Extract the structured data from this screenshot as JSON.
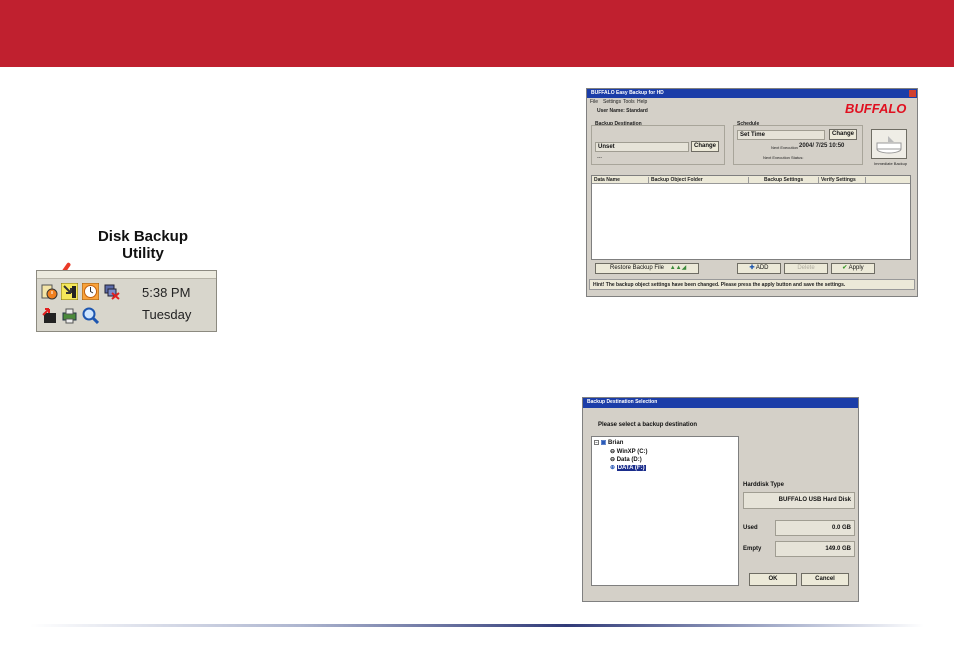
{
  "callout": {
    "line1": "Disk Backup",
    "line2": "Utility"
  },
  "tray": {
    "time": "5:38 PM",
    "day": "Tuesday"
  },
  "main_window": {
    "title": "BUFFALO Easy Backup for HD",
    "menu": [
      "File",
      "Settings",
      "Tools",
      "Help"
    ],
    "user_label": "User Name: Standard",
    "brand": "BUFFALO",
    "backup_destination": {
      "label": "Backup Destination",
      "value": "Unset",
      "sub": "---",
      "button": "Change"
    },
    "schedule": {
      "label": "Schedule",
      "value": "Set Time",
      "button": "Change",
      "next_label": "Next Execution",
      "next_value": "2004/ 7/25 10:50",
      "status_label": "Next Execution Status:",
      "immediate_label": "Immediate Backup"
    },
    "table_headers": [
      "Data Name",
      "Backup Object Folder",
      "Backup Settings",
      "Verify Settings",
      ""
    ],
    "buttons": {
      "restore": "Restore Backup File",
      "add": "ADD",
      "delete": "Delete",
      "apply": "Apply"
    },
    "hint": "Hint! The backup object settings have been changed. Please press the apply button and save the settings."
  },
  "dest_dialog": {
    "title": "Backup Destination Selection",
    "prompt": "Please select a backup destination",
    "tree": {
      "root": "Brian",
      "drives": [
        "WinXP (C:)",
        "Data (D:)",
        "DATA (F:)"
      ]
    },
    "hdd_type_label": "Harddisk Type",
    "hdd_type_value": "BUFFALO USB Hard Disk",
    "used_label": "Used",
    "used_value": "0.0 GB",
    "empty_label": "Empty",
    "empty_value": "149.0 GB",
    "ok": "OK",
    "cancel": "Cancel"
  },
  "colors": {
    "band": "#c0202f",
    "brand_red": "#e01020",
    "selection": "#1a2d8c"
  }
}
